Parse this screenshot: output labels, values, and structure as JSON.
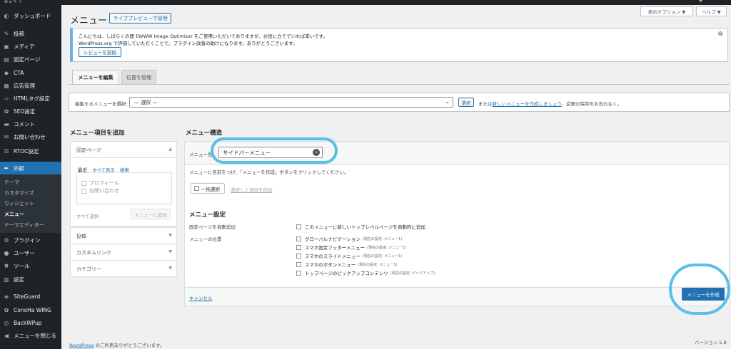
{
  "sidebar": {
    "items": [
      {
        "label": "ダッシュボード",
        "icon": "dashboard-icon"
      },
      {
        "label": "投稿",
        "icon": "pin-icon"
      },
      {
        "label": "メディア",
        "icon": "media-icon"
      },
      {
        "label": "固定ページ",
        "icon": "page-icon"
      },
      {
        "label": "CTA",
        "icon": "tag-icon"
      },
      {
        "label": "広告管理",
        "icon": "ad-icon"
      },
      {
        "label": "HTMLタグ設定",
        "icon": "code-icon"
      },
      {
        "label": "SEO設定",
        "icon": "gear-icon"
      },
      {
        "label": "コメント",
        "icon": "comment-icon"
      },
      {
        "label": "お問い合わせ",
        "icon": "mail-icon"
      },
      {
        "label": "RTOC設定",
        "icon": "list-icon"
      },
      {
        "label": "外観",
        "icon": "brush-icon"
      }
    ],
    "submenu": [
      "テーマ",
      "カスタマイズ",
      "ウィジェット",
      "メニュー",
      "テーマエディター"
    ],
    "items_after": [
      {
        "label": "プラグイン",
        "icon": "plugin-icon"
      },
      {
        "label": "ユーザー",
        "icon": "user-icon"
      },
      {
        "label": "ツール",
        "icon": "wrench-icon"
      },
      {
        "label": "設定",
        "icon": "settings-icon"
      }
    ],
    "items_bottom": [
      {
        "label": "SiteGuard",
        "icon": "shield-icon"
      },
      {
        "label": "ConoHa WING",
        "icon": "gear-icon"
      },
      {
        "label": "BackWPup",
        "icon": "backup-icon"
      },
      {
        "label": "メニューを閉じる",
        "icon": "collapse-icon"
      }
    ]
  },
  "header": {
    "screen_options": "表示オプション ▼",
    "help": "ヘルプ ▼",
    "title": "メニュー",
    "live_preview": "ライブプレビューで管理"
  },
  "notice": {
    "line1": "こんにちは、しばらくの間 EWWW Image Optimizer をご使用いただいておりますが、お役に立てていれば幸いです。",
    "line2": "WordPress.org で評価していただくことで、プラグイン改善の助けになります。ありがとうございます。",
    "review_button": "レビューを投稿",
    "dismiss": "⊗"
  },
  "tabs": [
    "メニューを編集",
    "位置を管理"
  ],
  "select_menu": {
    "label": "編集するメニューを選択:",
    "value": "— 選択 —",
    "button": "選択",
    "tail_prefix": "または",
    "tail_link": "新しいメニューを作成しましょう",
    "tail_suffix": "。変更の保存をお忘れなく。"
  },
  "add_items": {
    "heading": "メニュー項目を追加",
    "panel_title": "固定ページ",
    "subtabs": [
      "最近",
      "すべて表示",
      "検索"
    ],
    "items": [
      "プロフィール",
      "お問い合わせ"
    ],
    "select_all": "すべて選択",
    "add_button": "メニューに追加",
    "other_panels": [
      "投稿",
      "カスタムリンク",
      "カテゴリー"
    ]
  },
  "structure": {
    "heading": "メニュー構造",
    "name_label": "メニュー名",
    "name_value": "サイドバーメニュー",
    "instructions": "メニューに名前をつけ、「メニューを作成」ボタンをクリックしてください。",
    "bulk_select": "一括選択",
    "delete_selected": "選択した項目を削除",
    "settings_heading": "メニュー設定",
    "auto_add_label": "固定ページを自動追加",
    "auto_add_option": "このメニューに新しいトップレベルページを自動的に追加",
    "location_label": "メニューの位置",
    "locations": [
      {
        "name": "グローバルナビゲーション",
        "note": "(現在の設定: メニュー1)"
      },
      {
        "name": "スマホ固定フッターメニュー",
        "note": "(現在の設定: メニュー1)"
      },
      {
        "name": "スマホのスライドメニュー",
        "note": "(現在の設定: メニュー1)"
      },
      {
        "name": "スマホのボタンメニュー",
        "note": "(現在の設定: メニュー1)"
      },
      {
        "name": "トップページのピックアップコンテンツ",
        "note": "(現在の設定: ピックアップ)"
      }
    ],
    "cancel": "キャンセル",
    "create_button": "メニューを作成"
  },
  "footer": {
    "wp_link": "WordPress",
    "thanks_suffix": " のご利用ありがとうございます。",
    "version": "バージョン 5.8"
  },
  "colors": {
    "accent": "#2271b1",
    "sidebar": "#1d2327",
    "highlight": "#5bbfe6"
  }
}
